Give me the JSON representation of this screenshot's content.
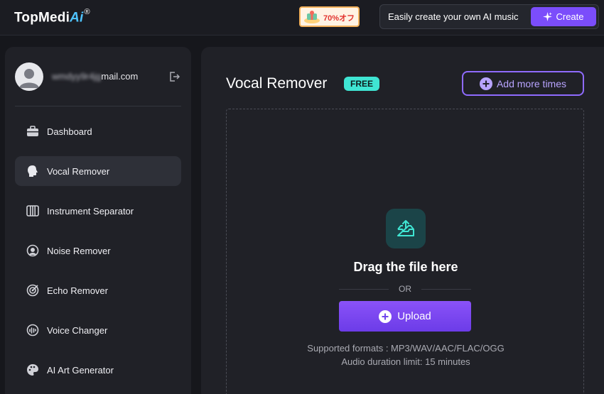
{
  "header": {
    "logo_text": "TopMedi",
    "logo_ai": "Ai",
    "logo_mark": "®",
    "promo_label": "70%オフ",
    "tagline": "Easily create your own AI music",
    "create_label": "Create"
  },
  "sidebar": {
    "email_hidden": "wmdyy9r4jg",
    "email_visible": "mail.com",
    "items": [
      {
        "label": "Dashboard",
        "icon": "briefcase-icon"
      },
      {
        "label": "Vocal Remover",
        "icon": "head-icon",
        "active": true
      },
      {
        "label": "Instrument Separator",
        "icon": "piano-icon"
      },
      {
        "label": "Noise Remover",
        "icon": "noise-icon"
      },
      {
        "label": "Echo Remover",
        "icon": "echo-icon"
      },
      {
        "label": "Voice Changer",
        "icon": "voice-changer-icon"
      },
      {
        "label": "AI Art Generator",
        "icon": "palette-icon"
      }
    ]
  },
  "main": {
    "title": "Vocal Remover",
    "badge": "FREE",
    "add_more_label": "Add more times",
    "drag_text": "Drag the file here",
    "or_text": "OR",
    "upload_label": "Upload",
    "formats_text": "Supported formats : MP3/WAV/AAC/FLAC/OGG",
    "duration_text": "Audio duration limit: 15 minutes"
  },
  "colors": {
    "accent": "#7b4dfb",
    "badge": "#3fe5d3",
    "icon_teal": "#3fe5d3"
  }
}
